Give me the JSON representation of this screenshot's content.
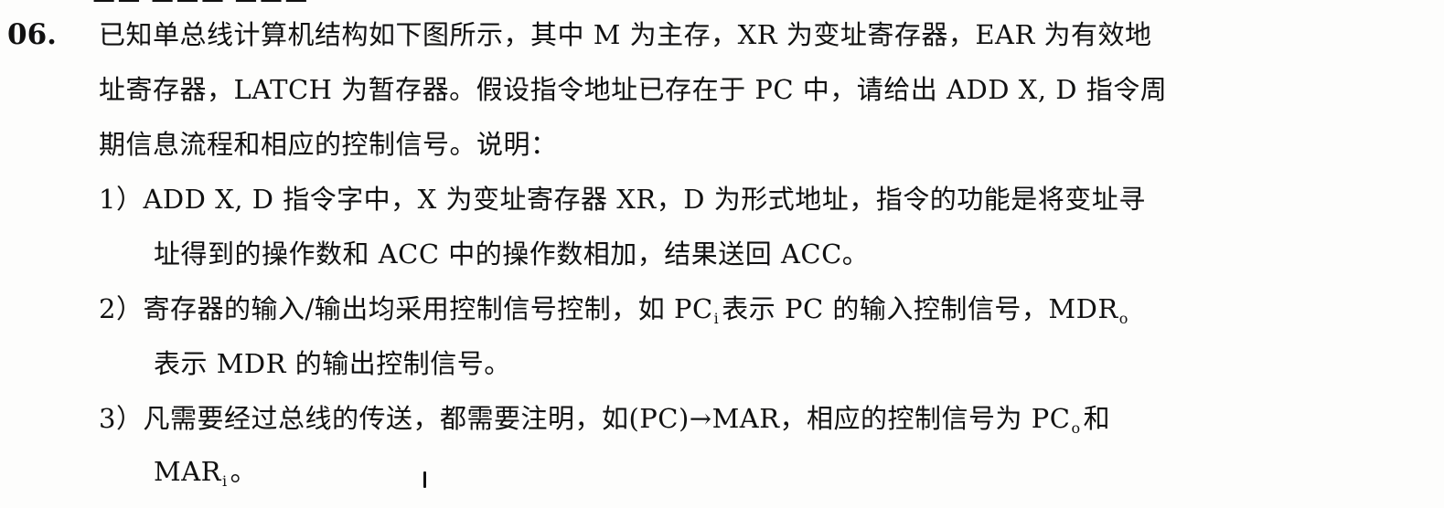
{
  "question": {
    "number": "06.",
    "intro_lines": [
      "已知单总线计算机结构如下图所示，其中 M 为主存，XR 为变址寄存器，EAR 为有效地",
      "址寄存器，LATCH 为暂存器。假设指令地址已存在于 PC 中，请给出 ADD X, D 指令周",
      "期信息流程和相应的控制信号。说明："
    ],
    "item1": {
      "line1": "1）ADD X, D 指令字中，X 为变址寄存器 XR，D 为形式地址，指令的功能是将变址寻",
      "line2": "址得到的操作数和 ACC 中的操作数相加，结果送回 ACC。"
    },
    "item2": {
      "line1_a": "2）寄存器的输入/输出均采用控制信号控制，如 PC",
      "sub_i": "i",
      "line1_b": "表示 PC 的输入控制信号，MDR",
      "sub_o": "o",
      "line2": "表示 MDR 的输出控制信号。"
    },
    "item3": {
      "line1_a": "3）凡需要经过总线的传送，都需要注明，如(PC)→MAR，相应的控制信号为 PC",
      "sub_o": "o",
      "line1_b": "和",
      "line2_a": "MAR",
      "sub_i": "i",
      "line2_b": "。"
    }
  }
}
